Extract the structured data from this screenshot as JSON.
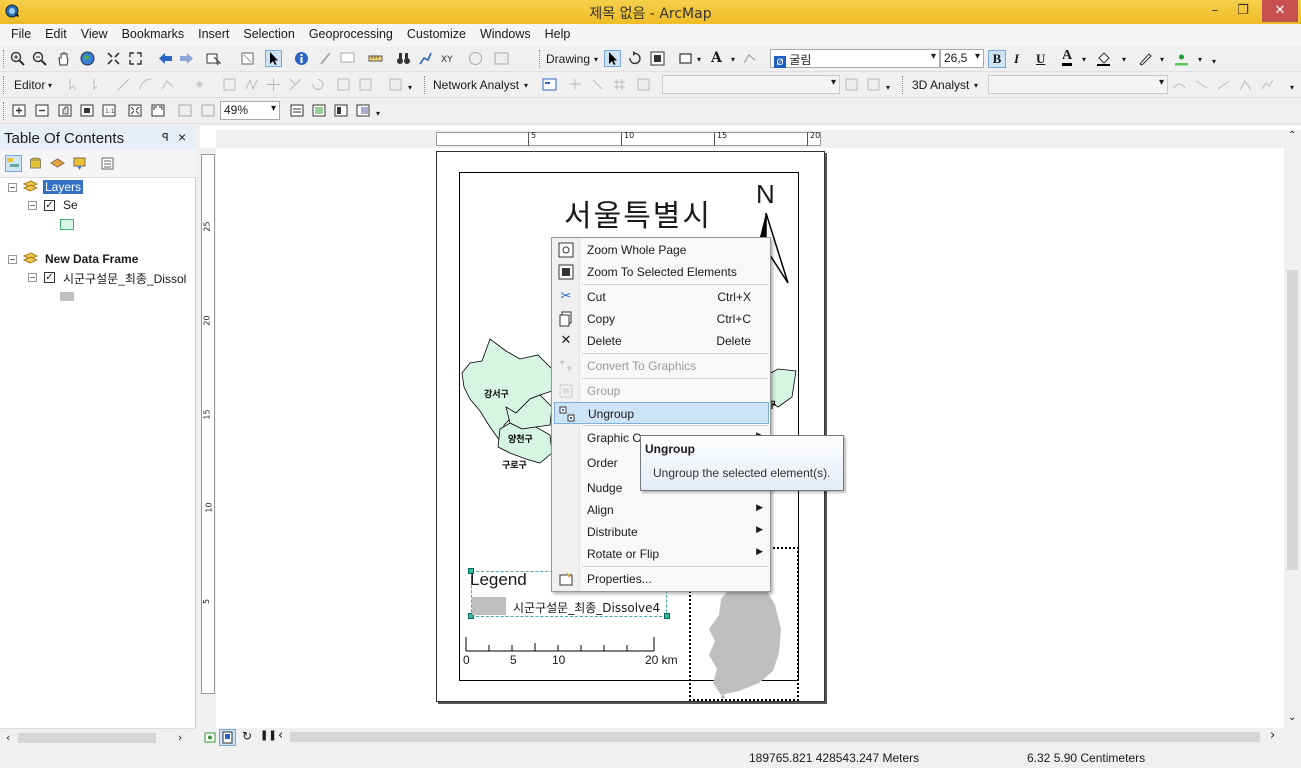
{
  "window": {
    "title": "제목 없음 - ArcMap",
    "min": "–",
    "max": "❐",
    "close": "✕"
  },
  "menu": [
    "File",
    "Edit",
    "View",
    "Bookmarks",
    "Insert",
    "Selection",
    "Geoprocessing",
    "Customize",
    "Windows",
    "Help"
  ],
  "toolbar1": {
    "drawing_label": "Drawing",
    "font_name": "굴림",
    "font_size": "26,5",
    "bold": "B",
    "italic": "I",
    "underline": "U",
    "font_color_label": "A"
  },
  "toolbar2": {
    "editor_label": "Editor",
    "network_label": "Network Analyst",
    "analyst3d_label": "3D Analyst"
  },
  "toolbar3": {
    "zoom_value": "49%"
  },
  "toc": {
    "title": "Table Of Contents",
    "pin": "ᵖ",
    "close": "×",
    "frame1": {
      "name": "Layers",
      "layer": "Se"
    },
    "frame2": {
      "name": "New Data Frame",
      "layer": "시군구설문_최종_Dissol"
    }
  },
  "layout": {
    "ruler_top": [
      "5",
      "10",
      "15",
      "20"
    ],
    "ruler_left": [
      "25",
      "20",
      "15",
      "10",
      "5"
    ],
    "map_title": "서울특별시",
    "north_label": "N",
    "district_labels": [
      "강서구",
      "양천구",
      "구로구",
      "구"
    ],
    "legend_title": "Legend",
    "legend_item": "시군구설문_최종_Dissolve4",
    "scale_labels": [
      "0",
      "5",
      "10",
      "20 km"
    ]
  },
  "context_menu": [
    {
      "label": "Zoom Whole Page",
      "shortcut": "",
      "icon": "zoom-page-icon"
    },
    {
      "label": "Zoom To Selected Elements",
      "shortcut": "",
      "icon": "zoom-selected-icon"
    },
    {
      "label": "Cut",
      "shortcut": "Ctrl+X",
      "icon": "scissors-icon"
    },
    {
      "label": "Copy",
      "shortcut": "Ctrl+C",
      "icon": "copy-icon"
    },
    {
      "label": "Delete",
      "shortcut": "Delete",
      "icon": "delete-icon"
    },
    {
      "label": "Convert To Graphics",
      "shortcut": "",
      "icon": "convert-icon"
    },
    {
      "label": "Group",
      "shortcut": "",
      "icon": "group-icon"
    },
    {
      "label": "Ungroup",
      "shortcut": "",
      "icon": "ungroup-icon"
    },
    {
      "label": "Graphic O",
      "shortcut": "",
      "icon": ""
    },
    {
      "label": "Order",
      "shortcut": "",
      "icon": ""
    },
    {
      "label": "Nudge",
      "shortcut": "",
      "icon": ""
    },
    {
      "label": "Align",
      "shortcut": "",
      "icon": ""
    },
    {
      "label": "Distribute",
      "shortcut": "",
      "icon": ""
    },
    {
      "label": "Rotate or Flip",
      "shortcut": "",
      "icon": ""
    },
    {
      "label": "Properties...",
      "shortcut": "",
      "icon": "properties-icon"
    }
  ],
  "tooltip": {
    "title": "Ungroup",
    "description": "Ungroup the selected element(s)."
  },
  "status": {
    "coords": "189765.821  428543.247 Meters",
    "page_coords": "6.32  5.90 Centimeters"
  },
  "colors": {
    "titlebar": "#f1c232",
    "map_fill": "#d7f5e3",
    "highlight": "#cde4f7",
    "close": "#c75050"
  }
}
